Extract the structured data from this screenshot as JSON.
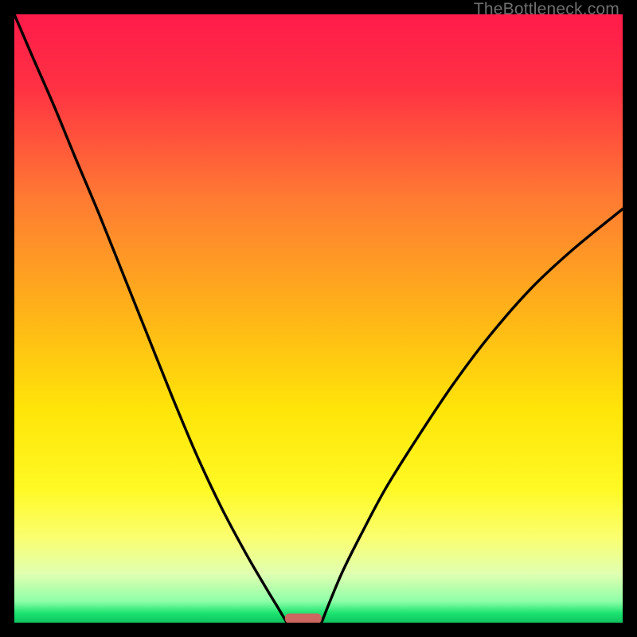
{
  "watermark": "TheBottleneck.com",
  "chart_data": {
    "type": "line",
    "title": "",
    "xlabel": "",
    "ylabel": "",
    "xlim": [
      0,
      100
    ],
    "ylim": [
      0,
      100
    ],
    "gradient_stops": [
      {
        "offset": 0.0,
        "color": "#ff1b4a"
      },
      {
        "offset": 0.12,
        "color": "#ff3143"
      },
      {
        "offset": 0.3,
        "color": "#ff7a33"
      },
      {
        "offset": 0.5,
        "color": "#ffb617"
      },
      {
        "offset": 0.65,
        "color": "#ffe508"
      },
      {
        "offset": 0.78,
        "color": "#fff924"
      },
      {
        "offset": 0.86,
        "color": "#fbff70"
      },
      {
        "offset": 0.92,
        "color": "#e0ffb1"
      },
      {
        "offset": 0.965,
        "color": "#8effa8"
      },
      {
        "offset": 0.985,
        "color": "#19e36e"
      },
      {
        "offset": 1.0,
        "color": "#10c160"
      }
    ],
    "series": [
      {
        "name": "left-curve",
        "x": [
          0.0,
          3.0,
          6.5,
          10.0,
          14.0,
          18.0,
          22.0,
          26.0,
          30.0,
          34.0,
          38.0,
          41.5,
          43.5,
          44.8
        ],
        "y": [
          100.0,
          93.0,
          85.0,
          76.5,
          67.0,
          57.0,
          47.0,
          37.0,
          27.5,
          19.0,
          11.5,
          5.5,
          2.2,
          0.0
        ]
      },
      {
        "name": "right-curve",
        "x": [
          50.5,
          52.0,
          54.0,
          57.0,
          61.0,
          66.0,
          72.0,
          78.0,
          85.0,
          92.0,
          100.0
        ],
        "y": [
          0.0,
          3.8,
          8.5,
          14.5,
          22.0,
          30.0,
          39.0,
          47.0,
          55.0,
          61.5,
          68.0
        ]
      }
    ],
    "marker": {
      "name": "bottleneck-marker",
      "x_center": 47.5,
      "width": 6.0,
      "y": 0.7,
      "height": 1.6,
      "color": "#cc6660"
    }
  }
}
